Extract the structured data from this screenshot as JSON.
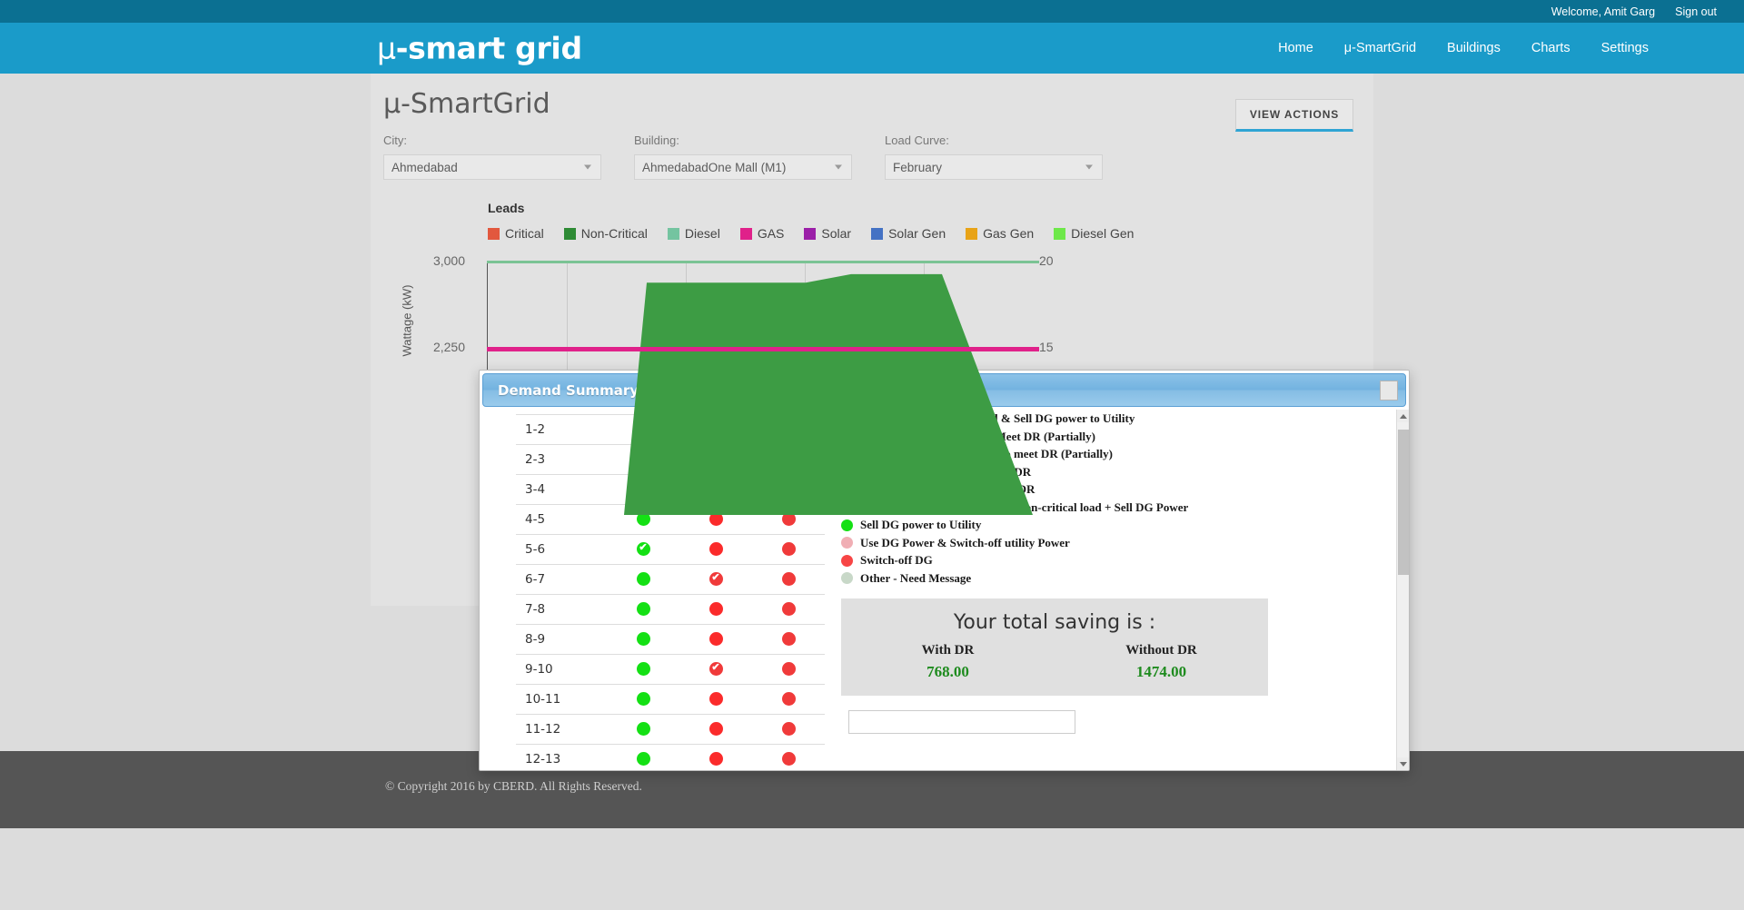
{
  "topbar": {
    "welcome": "Welcome, Amit Garg",
    "signout": "Sign out"
  },
  "brand": {
    "mu": "μ",
    "name": "-smart grid"
  },
  "nav": [
    {
      "label": "Home"
    },
    {
      "label": "μ-SmartGrid"
    },
    {
      "label": "Buildings"
    },
    {
      "label": "Charts"
    },
    {
      "label": "Settings"
    }
  ],
  "page": {
    "title": "μ-SmartGrid",
    "view_actions": "VIEW ACTIONS"
  },
  "filters": {
    "city": {
      "label": "City:",
      "value": "Ahmedabad"
    },
    "building": {
      "label": "Building:",
      "value": "AhmedabadOne Mall (M1)"
    },
    "loadcurve": {
      "label": "Load Curve:",
      "value": "February"
    }
  },
  "chart_data": {
    "type": "area",
    "title": "Leads",
    "ylabel": "Wattage (kW)",
    "y_left_ticks": [
      "3,000",
      "2,250"
    ],
    "y_right_ticks": [
      "20",
      "15"
    ],
    "ylim": [
      1500,
      3000
    ],
    "y2lim": [
      10,
      20
    ],
    "grid": true,
    "legend_position": "top",
    "legend": [
      {
        "label": "Critical",
        "color": "#e2583e"
      },
      {
        "label": "Non-Critical",
        "color": "#2e8b35"
      },
      {
        "label": "Diesel",
        "color": "#74c4a0"
      },
      {
        "label": "GAS",
        "color": "#e0218a"
      },
      {
        "label": "Solar",
        "color": "#9b1fa8"
      },
      {
        "label": "Solar Gen",
        "color": "#4472c4"
      },
      {
        "label": "Gas Gen",
        "color": "#e8a317"
      },
      {
        "label": "Diesel Gen",
        "color": "#6ee84a"
      }
    ],
    "series": [
      {
        "name": "Diesel",
        "type": "line",
        "color": "#7bc394",
        "value": 3000
      },
      {
        "name": "GAS",
        "type": "line",
        "color": "#e0218a",
        "value": 2250
      },
      {
        "name": "Non-Critical",
        "type": "area",
        "color": "#3d9c44",
        "x": [
          0,
          6,
          7,
          14,
          16,
          20,
          24
        ],
        "y": [
          0,
          0,
          2870,
          2870,
          2920,
          2920,
          0
        ]
      }
    ]
  },
  "modal": {
    "title": "Demand Summary",
    "close": "close-icon",
    "table": {
      "rows": [
        {
          "slot": "1-2",
          "c1": {
            "color": "#14e014",
            "check": false
          },
          "c2": {
            "color": "#fb2b2b",
            "check": false
          },
          "c3": {
            "color": "#f03a3a",
            "check": true
          }
        },
        {
          "slot": "2-3",
          "c1": {
            "color": "#14e014",
            "check": true
          },
          "c2": {
            "color": "#fb2b2b",
            "check": false
          },
          "c3": {
            "color": "#f03a3a",
            "check": true
          }
        },
        {
          "slot": "3-4",
          "c1": {
            "color": "#14e014",
            "check": true
          },
          "c2": {
            "color": "#fb2b2b",
            "check": false
          },
          "c3": {
            "color": "#f03a3a",
            "check": false
          }
        },
        {
          "slot": "4-5",
          "c1": {
            "color": "#14e014",
            "check": false
          },
          "c2": {
            "color": "#fb2b2b",
            "check": false
          },
          "c3": {
            "color": "#f03a3a",
            "check": false
          }
        },
        {
          "slot": "5-6",
          "c1": {
            "color": "#14e014",
            "check": true
          },
          "c2": {
            "color": "#fb2b2b",
            "check": false
          },
          "c3": {
            "color": "#f03a3a",
            "check": false
          }
        },
        {
          "slot": "6-7",
          "c1": {
            "color": "#14e014",
            "check": false
          },
          "c2": {
            "color": "#f03a3a",
            "check": true
          },
          "c3": {
            "color": "#f03a3a",
            "check": false
          }
        },
        {
          "slot": "7-8",
          "c1": {
            "color": "#14e014",
            "check": false
          },
          "c2": {
            "color": "#fb2b2b",
            "check": false
          },
          "c3": {
            "color": "#f03a3a",
            "check": false
          }
        },
        {
          "slot": "8-9",
          "c1": {
            "color": "#14e014",
            "check": false
          },
          "c2": {
            "color": "#fb2b2b",
            "check": false
          },
          "c3": {
            "color": "#f03a3a",
            "check": false
          }
        },
        {
          "slot": "9-10",
          "c1": {
            "color": "#14e014",
            "check": false
          },
          "c2": {
            "color": "#f03a3a",
            "check": true
          },
          "c3": {
            "color": "#f03a3a",
            "check": false
          }
        },
        {
          "slot": "10-11",
          "c1": {
            "color": "#14e014",
            "check": false
          },
          "c2": {
            "color": "#fb2b2b",
            "check": false
          },
          "c3": {
            "color": "#f03a3a",
            "check": false
          }
        },
        {
          "slot": "11-12",
          "c1": {
            "color": "#14e014",
            "check": false
          },
          "c2": {
            "color": "#fb2b2b",
            "check": false
          },
          "c3": {
            "color": "#f03a3a",
            "check": false
          }
        },
        {
          "slot": "12-13",
          "c1": {
            "color": "#14e014",
            "check": false
          },
          "c2": {
            "color": "#fb2b2b",
            "check": false
          },
          "c3": {
            "color": "#f03a3a",
            "check": false
          }
        }
      ]
    },
    "legend": [
      {
        "color": "#0b4a0b",
        "label": "Switch-off non-critical load & Sell DG power to Utility"
      },
      {
        "color": "#00bb00",
        "label": "Sell DG power to utility to Meet DR (Partially)"
      },
      {
        "color": "#97e897",
        "label": "Switch-off non-critical load to meet DR (Partially)"
      },
      {
        "color": "#ff0000",
        "label": "Switch-off DG and don't meet DR"
      },
      {
        "color": "#8b0000",
        "label": "Switch-off critical load & meet DR"
      },
      {
        "color": "#0a3d0a",
        "label": "Run Critical load & Switch-off non-critical load + Sell DG Power"
      },
      {
        "color": "#14e014",
        "label": "Sell DG power to Utility"
      },
      {
        "color": "#f0aeb4",
        "label": "Use DG Power & Switch-off utility Power"
      },
      {
        "color": "#f74545",
        "label": "Switch-off DG"
      },
      {
        "color": "#c8d8c8",
        "label": "Other - Need Message"
      }
    ],
    "saving": {
      "title": "Your total saving is :",
      "with_dr_label": "With DR",
      "with_dr_value": "768.00",
      "without_dr_label": "Without DR",
      "without_dr_value": "1474.00"
    }
  },
  "footer": {
    "copyright": "© Copyright 2016 by CBERD. All Rights Reserved."
  }
}
